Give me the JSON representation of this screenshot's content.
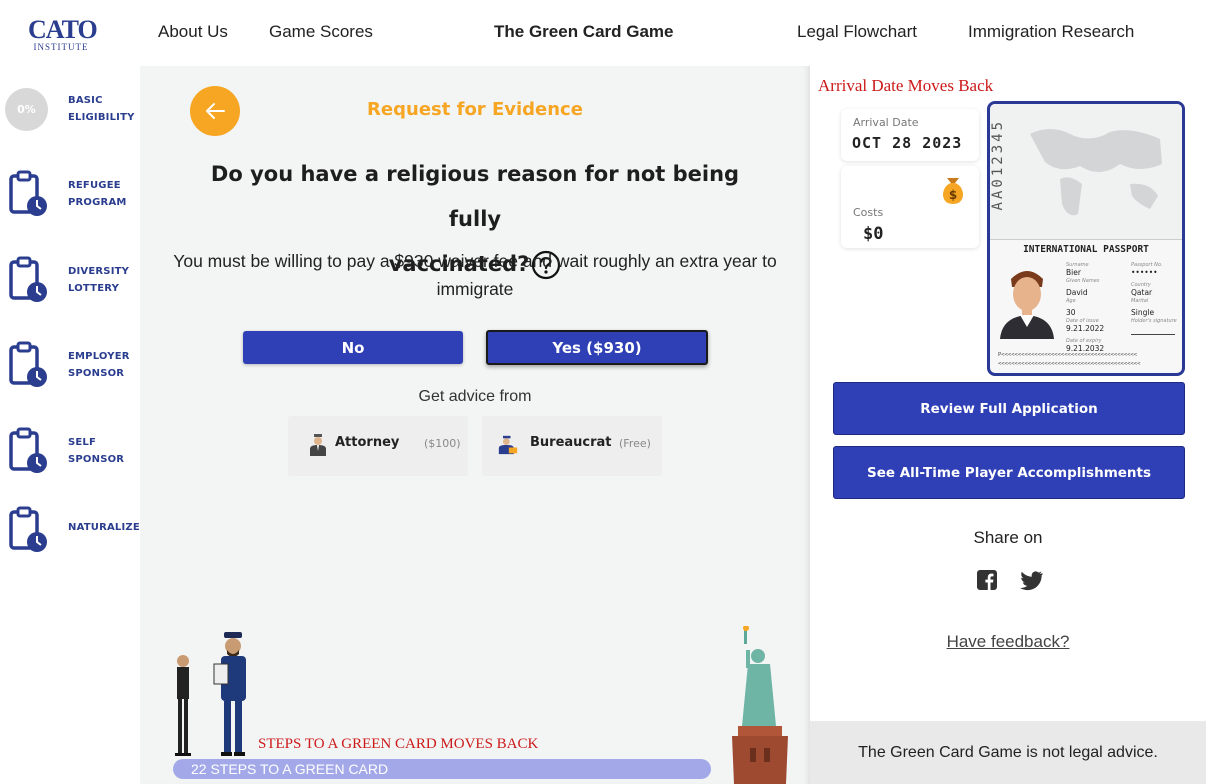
{
  "nav": {
    "logo_main": "CATO",
    "logo_sub": "INSTITUTE",
    "links": {
      "about": "About Us",
      "scores": "Game Scores",
      "title": "The Green Card Game",
      "flowchart": "Legal Flowchart",
      "research": "Immigration Research"
    }
  },
  "sidebar": {
    "progress": "0%",
    "items": [
      {
        "line1": "BASIC",
        "line2": "ELIGIBILITY"
      },
      {
        "line1": "REFUGEE",
        "line2": "PROGRAM"
      },
      {
        "line1": "DIVERSITY",
        "line2": "LOTTERY"
      },
      {
        "line1": "EMPLOYER",
        "line2": "SPONSOR"
      },
      {
        "line1": "SELF",
        "line2": "SPONSOR"
      },
      {
        "line1": "NATURALIZE",
        "line2": ""
      }
    ]
  },
  "main": {
    "heading": "Request for Evidence",
    "question_line1": "Do you have a religious reason for not being fully",
    "question_line2": "vaccinated?",
    "description": "You must be willing to pay a $930 waiver fee and wait roughly an extra year to immigrate",
    "btn_no": "No",
    "btn_yes": "Yes ($930)",
    "advice_label": "Get advice from",
    "advisors": [
      {
        "name": "Attorney",
        "price": "($100)"
      },
      {
        "name": "Bureaucrat",
        "price": "(Free)"
      }
    ],
    "steps_notice": "STEPS TO A GREEN CARD MOVES BACK",
    "steps_bar": "22 STEPS TO A GREEN CARD",
    "progress_fraction": 0
  },
  "right": {
    "arrival_notice": "Arrival Date Moves Back",
    "arrival_label": "Arrival Date",
    "arrival_value": "OCT 28 2023",
    "costs_label": "Costs",
    "costs_value": "$0",
    "passport": {
      "number": "AA012345",
      "title": "INTERNATIONAL PASSPORT",
      "surname_label": "Surname",
      "surname": "Bier",
      "given_label": "Given Names",
      "given": "David",
      "age_label": "Age",
      "age": "30",
      "issue_label": "Date of issue",
      "issue": "9.21.2022",
      "expiry_label": "Date of expiry",
      "expiry": "9.21.2032",
      "passport_no_label": "Passport No.",
      "passport_no": "••••••",
      "country_label": "Country",
      "country": "Qatar",
      "marital_label": "Marital",
      "marital": "Single",
      "signature_label": "Holder's signature",
      "mrz1": "P<<<<<<<<<<<<<<<<<<<<<<<<<<<<<<<<<<<<<<<<<",
      "mrz2": "<<<<<<<<<<<<<<<<<<<<<<<<<<<<<<<<<<<<<<<<<<<"
    },
    "btn_review": "Review Full Application",
    "btn_accomplishments": "See All-Time Player Accomplishments",
    "share_label": "Share on",
    "feedback": "Have feedback?",
    "footer": "The Green Card Game is not legal advice."
  },
  "colors": {
    "accent_orange": "#f6a623",
    "button_blue": "#2f3fb5",
    "nav_blue": "#2a3d8f",
    "notice_red": "#cc1a1a",
    "progress_bar": "#a3a9e8"
  }
}
